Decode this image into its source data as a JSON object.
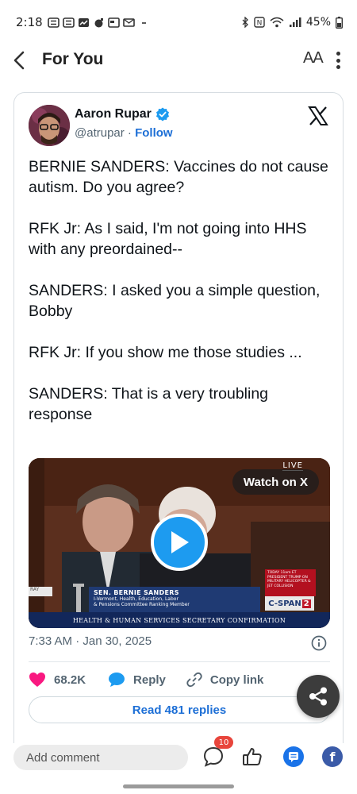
{
  "status_bar": {
    "time": "2:18",
    "battery": "45%"
  },
  "header": {
    "title": "For You",
    "font_size_label": "AA"
  },
  "tweet": {
    "author_name": "Aaron Rupar",
    "handle": "@atrupar",
    "separator": " · ",
    "follow_label": "Follow",
    "text": "BERNIE SANDERS: Vaccines do not cause autism. Do you agree?\n\nRFK Jr: As I said, I'm not going into HHS with any preordained--\n\nSANDERS: I asked you a simple question, Bobby\n\nRFK Jr: If you show me those studies ...\n\nSANDERS: That is a very troubling response",
    "video": {
      "live_label": "LIVE",
      "watch_label": "Watch on X",
      "chyron_name": "SEN. BERNIE SANDERS",
      "chyron_sub_1": "I-Vermont, Health, Education, Labor",
      "chyron_sub_2": "& Pensions Committee Ranking Member",
      "chyron_bottom": "HEALTH & HUMAN SERVICES SECRETARY CONFIRMATION",
      "chyron_left": "RAY",
      "network": "C-SPAN",
      "network_num": "2",
      "news_box": "TODAY 11am ET PRESIDENT TRUMP ON MILITARY HELICOPTER & JET COLLISION"
    },
    "timestamp": "7:33 AM · Jan 30, 2025",
    "likes": "68.2K",
    "reply_label": "Reply",
    "copy_link_label": "Copy link",
    "read_replies_label": "Read 481 replies"
  },
  "bottom_bar": {
    "comment_placeholder": "Add comment",
    "comments_badge": "10"
  },
  "colors": {
    "accent_blue": "#1d6fd6",
    "like_pink": "#f91880",
    "play_blue": "#1d9bf0",
    "badge_red": "#e8453c"
  }
}
